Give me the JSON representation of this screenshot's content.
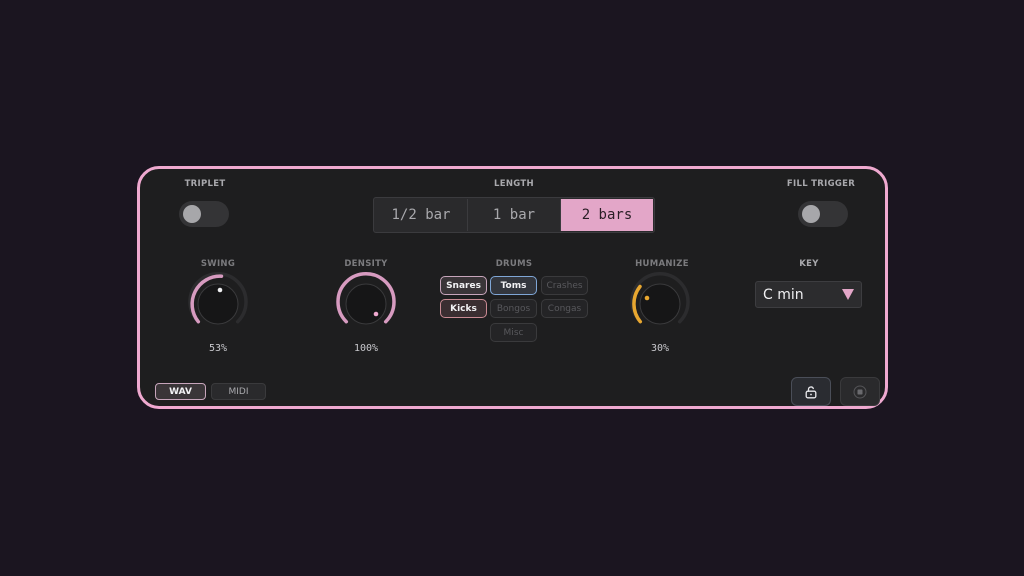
{
  "triplet": {
    "label": "TRIPLET",
    "on": false
  },
  "length": {
    "label": "LENGTH",
    "options": [
      "1/2  bar",
      "1  bar",
      "2  bars"
    ],
    "selected": "2  bars"
  },
  "fill_trigger": {
    "label": "FILL TRIGGER",
    "on": false
  },
  "swing": {
    "label": "SWING",
    "value": 53,
    "display": "53%"
  },
  "density": {
    "label": "DENSITY",
    "value": 100,
    "display": "100%"
  },
  "drums": {
    "label": "DRUMS",
    "items": [
      {
        "label": "Snares",
        "active": true
      },
      {
        "label": "Toms",
        "active": true
      },
      {
        "label": "Crashes",
        "active": false
      },
      {
        "label": "Kicks",
        "active": true
      },
      {
        "label": "Bongos",
        "active": false
      },
      {
        "label": "Congas",
        "active": false
      },
      {
        "label": "Misc",
        "active": false
      }
    ]
  },
  "humanize": {
    "label": "HUMANIZE",
    "value": 30,
    "display": "30%"
  },
  "key": {
    "label": "KEY",
    "value": "C min"
  },
  "format": {
    "wav": "WAV",
    "midi": "MIDI",
    "selected": "WAV"
  },
  "icons": {
    "lock": "unlock-icon",
    "stop": "stop-icon"
  },
  "colors": {
    "accent": "#efa9d0",
    "active_segment": "#e3a6c8",
    "humanize_arc": "#e8a730",
    "toms_border": "#7fa6d6",
    "kicks_border": "#c98a93"
  }
}
